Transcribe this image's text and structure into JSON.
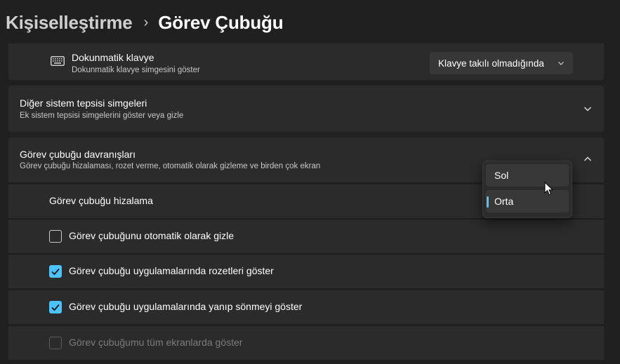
{
  "breadcrumb": {
    "parent": "Kişiselleştirme",
    "separator": "›",
    "current": "Görev Çubuğu"
  },
  "touch_keyboard": {
    "icon": "keyboard-icon",
    "title": "Dokunmatik klavye",
    "subtitle": "Dokunmatik klavye simgesini göster",
    "dropdown_value": "Klavye takılı olmadığında"
  },
  "system_tray": {
    "title": "Diğer sistem tepsisi simgeleri",
    "subtitle": "Ek sistem tepsisi simgelerini göster veya gizle",
    "expanded": false
  },
  "behaviors": {
    "title": "Görev çubuğu davranışları",
    "subtitle": "Görev çubuğu hizalaması, rozet verme, otomatik olarak gizleme ve birden çok ekran",
    "expanded": true,
    "alignment_label": "Görev çubuğu hizalama",
    "alignment_options": [
      "Sol",
      "Orta"
    ],
    "alignment_selected": "Orta",
    "options": [
      {
        "label": "Görev çubuğunu otomatik olarak gizle",
        "checked": false,
        "enabled": true
      },
      {
        "label": "Görev çubuğu uygulamalarında rozetleri göster",
        "checked": true,
        "enabled": true
      },
      {
        "label": "Görev çubuğu uygulamalarında yanıp sönmeyi göster",
        "checked": true,
        "enabled": true
      },
      {
        "label": "Görev çubuğumu tüm ekranlarda göster",
        "checked": false,
        "enabled": false
      }
    ]
  },
  "colors": {
    "background": "#202020",
    "card": "#2b2b2b",
    "accent": "#4cc2ff"
  }
}
